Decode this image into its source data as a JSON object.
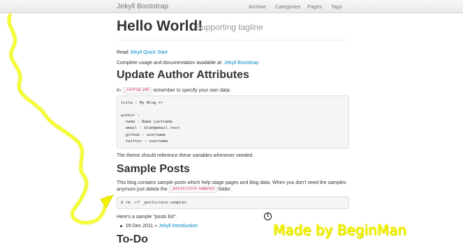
{
  "navbar": {
    "brand": "Jekyll Bootstrap",
    "items": [
      {
        "label": "Archive"
      },
      {
        "label": "Categories"
      },
      {
        "label": "Pages"
      },
      {
        "label": "Tags"
      }
    ]
  },
  "header": {
    "title": "Hello World!",
    "tagline": "Supporting tagline"
  },
  "intro": {
    "read_prefix": "Read",
    "quick_start_link": "Jekyll Quick Start",
    "docs_prefix": "Complete usage and documentation available at:",
    "docs_link": "Jekyll Bootstrap"
  },
  "author_section": {
    "heading": "Update Author Attributes",
    "pre_code": "In",
    "code": "_config.yml",
    "post_code": "remember to specify your own data:",
    "code_block": [
      "title : My Blog =)",
      "",
      "author :",
      "  name : Name Lastname",
      "  email : blah@email.test",
      "  github : username",
      "  twitter : username"
    ],
    "after": "The theme should reference these variables whenever needed."
  },
  "sample_section": {
    "heading": "Sample Posts",
    "line1": "This blog contains sample posts which help stage pages and blog data. When you don't need the samples",
    "line2_prefix": "anymore just delete the",
    "line2_code": "_posts/core-samples",
    "line2_suffix": "folder.",
    "command": "$ rm -rf _posts/core-samples",
    "list_intro": "Here's a sample \"posts list\".",
    "post_date": "29 Dec 2011 »",
    "post_link": "Jekyll Introduction"
  },
  "todo_heading": "To-Do",
  "annotation": {
    "marker": "1",
    "watermark": "Made by BeginMan",
    "color": "#f2f200"
  }
}
